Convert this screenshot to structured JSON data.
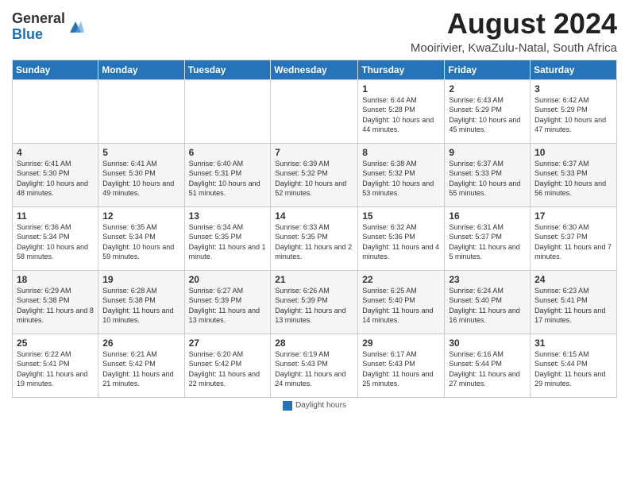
{
  "header": {
    "logo_general": "General",
    "logo_blue": "Blue",
    "title": "August 2024",
    "subtitle": "Mooirivier, KwaZulu-Natal, South Africa"
  },
  "calendar": {
    "days_of_week": [
      "Sunday",
      "Monday",
      "Tuesday",
      "Wednesday",
      "Thursday",
      "Friday",
      "Saturday"
    ],
    "weeks": [
      [
        {
          "day": "",
          "info": ""
        },
        {
          "day": "",
          "info": ""
        },
        {
          "day": "",
          "info": ""
        },
        {
          "day": "",
          "info": ""
        },
        {
          "day": "1",
          "info": "Sunrise: 6:44 AM\nSunset: 5:28 PM\nDaylight: 10 hours and 44 minutes."
        },
        {
          "day": "2",
          "info": "Sunrise: 6:43 AM\nSunset: 5:29 PM\nDaylight: 10 hours and 45 minutes."
        },
        {
          "day": "3",
          "info": "Sunrise: 6:42 AM\nSunset: 5:29 PM\nDaylight: 10 hours and 47 minutes."
        }
      ],
      [
        {
          "day": "4",
          "info": "Sunrise: 6:41 AM\nSunset: 5:30 PM\nDaylight: 10 hours and 48 minutes."
        },
        {
          "day": "5",
          "info": "Sunrise: 6:41 AM\nSunset: 5:30 PM\nDaylight: 10 hours and 49 minutes."
        },
        {
          "day": "6",
          "info": "Sunrise: 6:40 AM\nSunset: 5:31 PM\nDaylight: 10 hours and 51 minutes."
        },
        {
          "day": "7",
          "info": "Sunrise: 6:39 AM\nSunset: 5:32 PM\nDaylight: 10 hours and 52 minutes."
        },
        {
          "day": "8",
          "info": "Sunrise: 6:38 AM\nSunset: 5:32 PM\nDaylight: 10 hours and 53 minutes."
        },
        {
          "day": "9",
          "info": "Sunrise: 6:37 AM\nSunset: 5:33 PM\nDaylight: 10 hours and 55 minutes."
        },
        {
          "day": "10",
          "info": "Sunrise: 6:37 AM\nSunset: 5:33 PM\nDaylight: 10 hours and 56 minutes."
        }
      ],
      [
        {
          "day": "11",
          "info": "Sunrise: 6:36 AM\nSunset: 5:34 PM\nDaylight: 10 hours and 58 minutes."
        },
        {
          "day": "12",
          "info": "Sunrise: 6:35 AM\nSunset: 5:34 PM\nDaylight: 10 hours and 59 minutes."
        },
        {
          "day": "13",
          "info": "Sunrise: 6:34 AM\nSunset: 5:35 PM\nDaylight: 11 hours and 1 minute."
        },
        {
          "day": "14",
          "info": "Sunrise: 6:33 AM\nSunset: 5:35 PM\nDaylight: 11 hours and 2 minutes."
        },
        {
          "day": "15",
          "info": "Sunrise: 6:32 AM\nSunset: 5:36 PM\nDaylight: 11 hours and 4 minutes."
        },
        {
          "day": "16",
          "info": "Sunrise: 6:31 AM\nSunset: 5:37 PM\nDaylight: 11 hours and 5 minutes."
        },
        {
          "day": "17",
          "info": "Sunrise: 6:30 AM\nSunset: 5:37 PM\nDaylight: 11 hours and 7 minutes."
        }
      ],
      [
        {
          "day": "18",
          "info": "Sunrise: 6:29 AM\nSunset: 5:38 PM\nDaylight: 11 hours and 8 minutes."
        },
        {
          "day": "19",
          "info": "Sunrise: 6:28 AM\nSunset: 5:38 PM\nDaylight: 11 hours and 10 minutes."
        },
        {
          "day": "20",
          "info": "Sunrise: 6:27 AM\nSunset: 5:39 PM\nDaylight: 11 hours and 13 minutes."
        },
        {
          "day": "21",
          "info": "Sunrise: 6:26 AM\nSunset: 5:39 PM\nDaylight: 11 hours and 13 minutes."
        },
        {
          "day": "22",
          "info": "Sunrise: 6:25 AM\nSunset: 5:40 PM\nDaylight: 11 hours and 14 minutes."
        },
        {
          "day": "23",
          "info": "Sunrise: 6:24 AM\nSunset: 5:40 PM\nDaylight: 11 hours and 16 minutes."
        },
        {
          "day": "24",
          "info": "Sunrise: 6:23 AM\nSunset: 5:41 PM\nDaylight: 11 hours and 17 minutes."
        }
      ],
      [
        {
          "day": "25",
          "info": "Sunrise: 6:22 AM\nSunset: 5:41 PM\nDaylight: 11 hours and 19 minutes."
        },
        {
          "day": "26",
          "info": "Sunrise: 6:21 AM\nSunset: 5:42 PM\nDaylight: 11 hours and 21 minutes."
        },
        {
          "day": "27",
          "info": "Sunrise: 6:20 AM\nSunset: 5:42 PM\nDaylight: 11 hours and 22 minutes."
        },
        {
          "day": "28",
          "info": "Sunrise: 6:19 AM\nSunset: 5:43 PM\nDaylight: 11 hours and 24 minutes."
        },
        {
          "day": "29",
          "info": "Sunrise: 6:17 AM\nSunset: 5:43 PM\nDaylight: 11 hours and 25 minutes."
        },
        {
          "day": "30",
          "info": "Sunrise: 6:16 AM\nSunset: 5:44 PM\nDaylight: 11 hours and 27 minutes."
        },
        {
          "day": "31",
          "info": "Sunrise: 6:15 AM\nSunset: 5:44 PM\nDaylight: 11 hours and 29 minutes."
        }
      ]
    ]
  },
  "footer": {
    "legend_label": "Daylight hours"
  }
}
